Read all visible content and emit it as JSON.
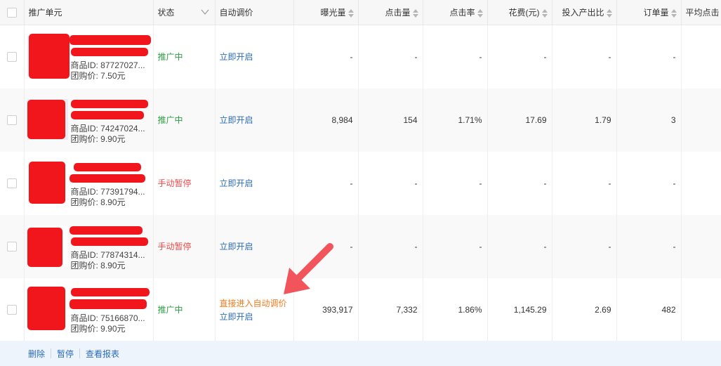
{
  "columns": {
    "unit": "推广单元",
    "status": "状态",
    "auto_bid": "自动调价",
    "impressions": "曝光量",
    "clicks": "点击量",
    "ctr": "点击率",
    "cost": "花费(元)",
    "roi": "投入产出比",
    "orders": "订单量",
    "avg_cpc": "平均点击"
  },
  "rows": [
    {
      "product_id": "商品ID: 87727027...",
      "group_price": "团购价: 7.50元",
      "status": "推广中",
      "status_type": "on",
      "auto_bid_note": "",
      "auto_bid": "立即开启",
      "impressions": "-",
      "clicks": "-",
      "ctr": "-",
      "cost": "-",
      "roi": "-",
      "orders": "-"
    },
    {
      "product_id": "商品ID: 74247024...",
      "group_price": "团购价: 9.90元",
      "status": "推广中",
      "status_type": "on",
      "auto_bid_note": "",
      "auto_bid": "立即开启",
      "impressions": "8,984",
      "clicks": "154",
      "ctr": "1.71%",
      "cost": "17.69",
      "roi": "1.79",
      "orders": "3"
    },
    {
      "product_id": "商品ID: 77391794...",
      "group_price": "团购价: 8.90元",
      "status": "手动暂停",
      "status_type": "pause",
      "auto_bid_note": "",
      "auto_bid": "立即开启",
      "impressions": "-",
      "clicks": "-",
      "ctr": "-",
      "cost": "-",
      "roi": "-",
      "orders": "-"
    },
    {
      "product_id": "商品ID: 77874314...",
      "group_price": "团购价: 8.90元",
      "status": "手动暂停",
      "status_type": "pause",
      "auto_bid_note": "",
      "auto_bid": "立即开启",
      "impressions": "-",
      "clicks": "-",
      "ctr": "-",
      "cost": "-",
      "roi": "-",
      "orders": "-"
    },
    {
      "product_id": "商品ID: 75166870...",
      "group_price": "团购价: 9.90元",
      "status": "推广中",
      "status_type": "on",
      "auto_bid_note": "直接进入自动调价",
      "auto_bid": "立即开启",
      "impressions": "393,917",
      "clicks": "7,332",
      "ctr": "1.86%",
      "cost": "1,145.29",
      "roi": "2.69",
      "orders": "482"
    }
  ],
  "footer": {
    "delete": "删除",
    "pause": "暂停",
    "report": "查看报表"
  },
  "colors": {
    "status_on": "#2e9e44",
    "status_pause": "#e84e4e",
    "link": "#2b6cb8",
    "highlight": "#f07b1d",
    "annotation_arrow": "#f2545b"
  }
}
